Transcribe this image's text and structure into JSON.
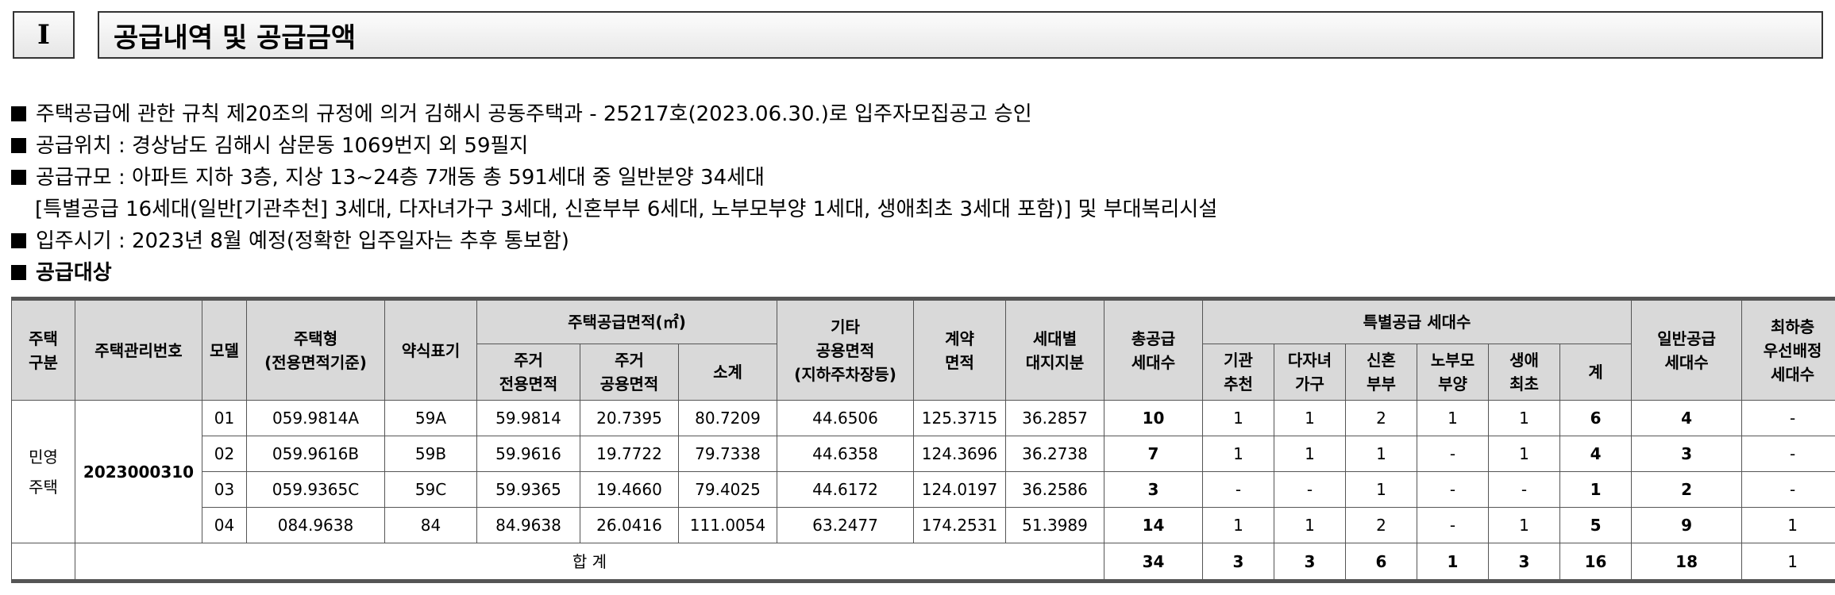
{
  "section": {
    "number": "I",
    "title": "공급내역 및 공급금액"
  },
  "notes": [
    "주택공급에 관한 규칙 제20조의 규정에 의거 김해시 공동주택과 - 25217호(2023.06.30.)로 입주자모집공고 승인",
    "공급위치 : 경상남도 김해시 삼문동 1069번지 외 59필지",
    "공급규모 : 아파트 지하 3층, 지상 13~24층 7개동 총 591세대 중 일반분양 34세대",
    "[특별공급 16세대(일반[기관추천] 3세대, 다자녀가구 3세대, 신혼부부 6세대, 노부모부양 1세대, 생애최초 3세대 포함)] 및 부대복리시설",
    "입주시기 : 2023년 8월 예정(정확한 입주일자는 추후 통보함)",
    "공급대상"
  ],
  "table": {
    "headers": {
      "housing_type": "주택\n구분",
      "mgmt_no": "주택관리번호",
      "model": "모델",
      "type": "주택형\n(전용면적기준)",
      "short": "약식표기",
      "area_group": "주택공급면적(㎡)",
      "area_exclusive": "주거\n전용면적",
      "area_common": "주거\n공용면적",
      "area_subtotal": "소계",
      "other_common": "기타\n공용면적\n(지하주차장등)",
      "contract_area": "계약\n면적",
      "land_share": "세대별\n대지지분",
      "total_units": "총공급\n세대수",
      "special_group": "특별공급 세대수",
      "sp_institution": "기관\n추천",
      "sp_multichild": "다자녀\n가구",
      "sp_newlywed": "신혼\n부부",
      "sp_elderly": "노부모\n부양",
      "sp_firsttime": "생애\n최초",
      "sp_total": "계",
      "general_units": "일반공급\n세대수",
      "lowest_floor": "최하층\n우선배정\n세대수"
    },
    "category": "민영\n주택",
    "mgmt_number": "2023000310",
    "rows": [
      {
        "model": "01",
        "type": "059.9814A",
        "short": "59A",
        "excl": "59.9814",
        "common": "20.7395",
        "subtotal": "80.7209",
        "other": "44.6506",
        "contract": "125.3715",
        "land": "36.2857",
        "total": "10",
        "inst": "1",
        "multi": "1",
        "newly": "2",
        "elder": "1",
        "first": "1",
        "sp_sum": "6",
        "general": "4",
        "lowest": "-"
      },
      {
        "model": "02",
        "type": "059.9616B",
        "short": "59B",
        "excl": "59.9616",
        "common": "19.7722",
        "subtotal": "79.7338",
        "other": "44.6358",
        "contract": "124.3696",
        "land": "36.2738",
        "total": "7",
        "inst": "1",
        "multi": "1",
        "newly": "1",
        "elder": "-",
        "first": "1",
        "sp_sum": "4",
        "general": "3",
        "lowest": "-"
      },
      {
        "model": "03",
        "type": "059.9365C",
        "short": "59C",
        "excl": "59.9365",
        "common": "19.4660",
        "subtotal": "79.4025",
        "other": "44.6172",
        "contract": "124.0197",
        "land": "36.2586",
        "total": "3",
        "inst": "-",
        "multi": "-",
        "newly": "1",
        "elder": "-",
        "first": "-",
        "sp_sum": "1",
        "general": "2",
        "lowest": "-"
      },
      {
        "model": "04",
        "type": "084.9638",
        "short": "84",
        "excl": "84.9638",
        "common": "26.0416",
        "subtotal": "111.0054",
        "other": "63.2477",
        "contract": "174.2531",
        "land": "51.3989",
        "total": "14",
        "inst": "1",
        "multi": "1",
        "newly": "2",
        "elder": "-",
        "first": "1",
        "sp_sum": "5",
        "general": "9",
        "lowest": "1"
      }
    ],
    "sum": {
      "label": "합 계",
      "total": "34",
      "inst": "3",
      "multi": "3",
      "newly": "6",
      "elder": "1",
      "first": "3",
      "sp_sum": "16",
      "general": "18",
      "lowest": "1"
    }
  }
}
